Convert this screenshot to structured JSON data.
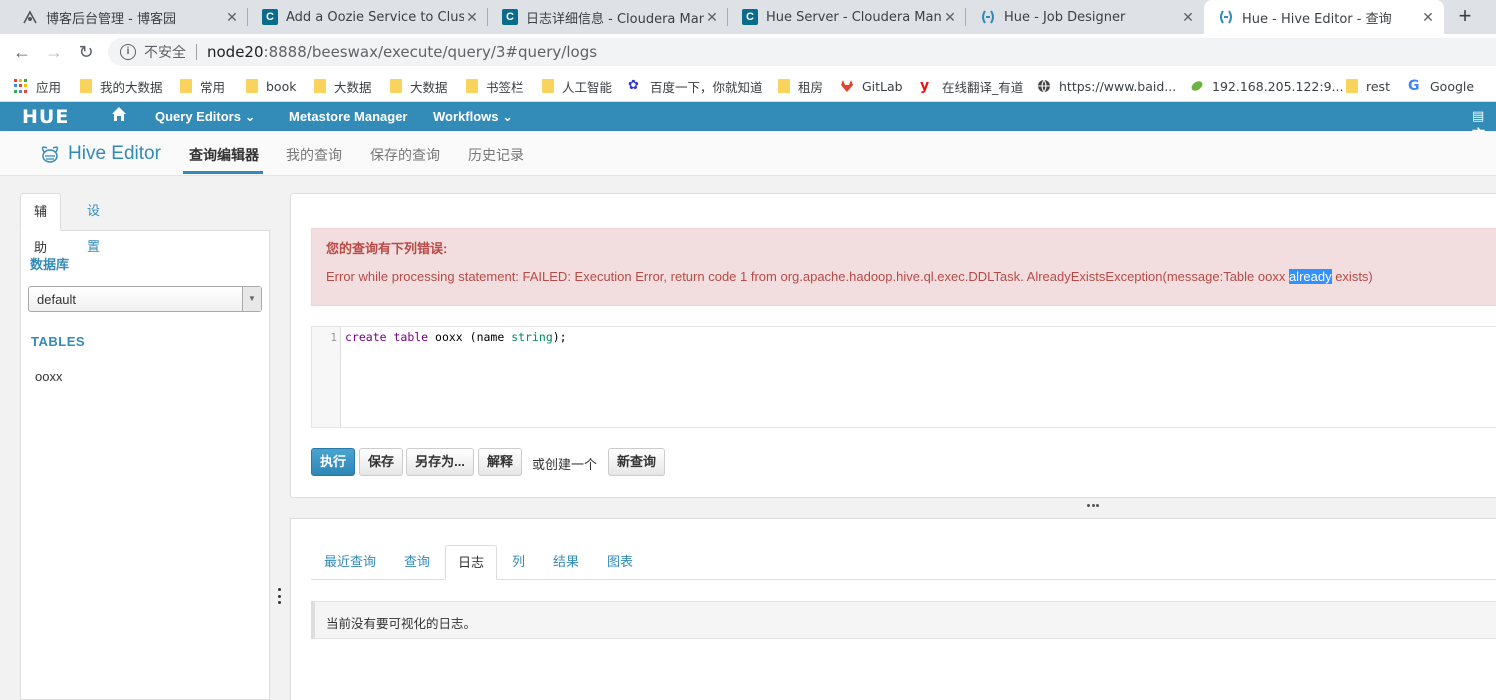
{
  "browser": {
    "tabs": [
      {
        "title": "博客后台管理 - 博客园",
        "icon": "cnblogs-icon"
      },
      {
        "title": "Add a Oozie Service to Cluster",
        "icon": "cloudera-icon"
      },
      {
        "title": "日志详细信息 - Cloudera Mana",
        "icon": "cloudera-icon"
      },
      {
        "title": "Hue Server - Cloudera Manage",
        "icon": "cloudera-icon"
      },
      {
        "title": "Hue - Job Designer",
        "icon": "hue-icon"
      },
      {
        "title": "Hue - Hive Editor - 查询",
        "icon": "hue-icon"
      }
    ],
    "address": {
      "security_label": "不安全",
      "host": "node20",
      "rest": ":8888/beeswax/execute/query/3#query/logs"
    },
    "bookmarks": [
      {
        "label": "应用",
        "icon": "apps-grid-icon"
      },
      {
        "label": "我的大数据",
        "icon": "folder-icon"
      },
      {
        "label": "常用",
        "icon": "folder-icon"
      },
      {
        "label": "book",
        "icon": "folder-icon"
      },
      {
        "label": "大数据",
        "icon": "folder-icon"
      },
      {
        "label": "大数据",
        "icon": "folder-icon"
      },
      {
        "label": "书签栏",
        "icon": "folder-icon"
      },
      {
        "label": "人工智能",
        "icon": "folder-icon"
      },
      {
        "label": "百度一下，你就知道",
        "icon": "baidu-paw-icon"
      },
      {
        "label": "租房",
        "icon": "folder-icon"
      },
      {
        "label": "GitLab",
        "icon": "gitlab-icon"
      },
      {
        "label": "在线翻译_有道",
        "icon": "youdao-icon"
      },
      {
        "label": "https://www.baid...",
        "icon": "globe-icon"
      },
      {
        "label": "192.168.205.122:9...",
        "icon": "leaf-icon"
      },
      {
        "label": "rest",
        "icon": "folder-icon"
      },
      {
        "label": "Google",
        "icon": "google-icon"
      }
    ]
  },
  "hue_nav": {
    "logo": "HUE",
    "items": [
      {
        "label": "Query Editors ⌄"
      },
      {
        "label": "Metastore Manager"
      },
      {
        "label": "Workflows ⌄"
      }
    ],
    "right_item": "文"
  },
  "subheader": {
    "app_title": "Hive Editor",
    "tabs": [
      "查询编辑器",
      "我的查询",
      "保存的查询",
      "历史记录"
    ]
  },
  "sidebar": {
    "tabs": [
      "辅助",
      "设置"
    ],
    "database_label": "数据库",
    "database_selected": "default",
    "tables_header": "TABLES",
    "tables": [
      "ooxx"
    ]
  },
  "editor": {
    "error_title": "您的查询有下列错误:",
    "error_before": "Error while processing statement: FAILED: Execution Error, return code 1 from org.apache.hadoop.hive.ql.exec.DDLTask. AlreadyExistsException(message:Table ooxx ",
    "error_highlight": "already",
    "error_after": " exists)",
    "line_number": "1",
    "code": {
      "kw1": "create",
      "kw2": "table",
      "ident": " ooxx (name ",
      "type": "string",
      "end": ");"
    },
    "buttons": {
      "execute": "执行",
      "save": "保存",
      "save_as": "另存为...",
      "explain": "解释",
      "or_create": "或创建一个",
      "new_query": "新查询"
    }
  },
  "results": {
    "tabs": [
      "最近查询",
      "查询",
      "日志",
      "列",
      "结果",
      "图表"
    ],
    "active_tab": "日志",
    "log_message": "当前没有要可视化的日志。"
  },
  "colors": {
    "hue_blue": "#338bb8",
    "error_bg": "#f2dede",
    "error_text": "#b94a48",
    "selection": "#3390ff"
  }
}
